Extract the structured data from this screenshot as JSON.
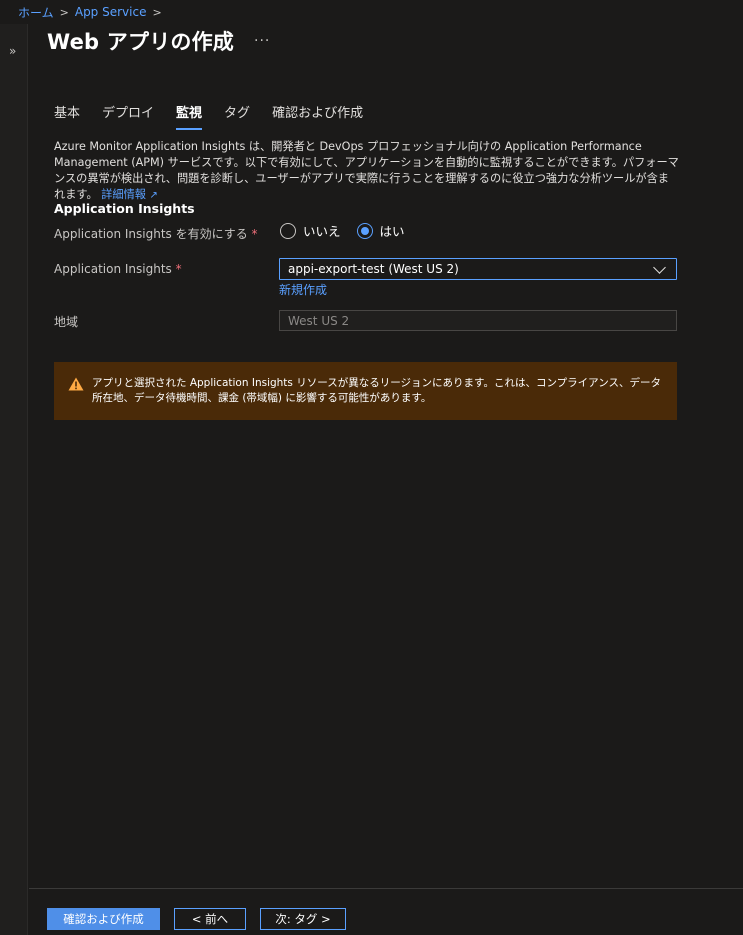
{
  "breadcrumb": {
    "home": "ホーム",
    "app_service": "App Service",
    "separator": ">"
  },
  "title": "Web アプリの作成",
  "title_more": "···",
  "left_rail": {
    "expand_glyph": "»"
  },
  "tabs": [
    {
      "label": "基本",
      "active": false
    },
    {
      "label": "デプロイ",
      "active": false
    },
    {
      "label": "監視",
      "active": true
    },
    {
      "label": "タグ",
      "active": false
    },
    {
      "label": "確認および作成",
      "active": false
    }
  ],
  "description": {
    "text": "Azure Monitor Application Insights は、開発者と DevOps プロフェッショナル向けの Application Performance Management (APM) サービスです。以下で有効にして、アプリケーションを自動的に監視することができます。パフォーマンスの異常が検出され、問題を診断し、ユーザーがアプリで実際に行うことを理解するのに役立つ強力な分析ツールが含まれます。",
    "link": "詳細情報",
    "link_icon": "external-link-icon"
  },
  "section_title": "Application Insights",
  "enable_field": {
    "label": "Application Insights を有効にする",
    "required_mark": "*",
    "options": [
      {
        "label": "いいえ",
        "checked": false
      },
      {
        "label": "はい",
        "checked": true
      }
    ]
  },
  "resource_field": {
    "label": "Application Insights",
    "required_mark": "*",
    "value": "appi-export-test (West US 2)",
    "create_new": "新規作成"
  },
  "region_field": {
    "label": "地域",
    "value": "West US 2"
  },
  "warning": {
    "text": "アプリと選択された Application Insights リソースが異なるリージョンにあります。これは、コンプライアンス、データ所在地、データ待機時間、課金 (帯域幅) に影響する可能性があります。",
    "color": "#4a2a08",
    "icon_color": "#ffaa44"
  },
  "footer": {
    "review_create": "確認および作成",
    "previous": "< 前へ",
    "next": "次: タグ >"
  },
  "colors": {
    "background": "#1b1a19",
    "accent": "#5aa0ff",
    "primary_button": "#4f8fe8",
    "required": "#f1707b"
  }
}
